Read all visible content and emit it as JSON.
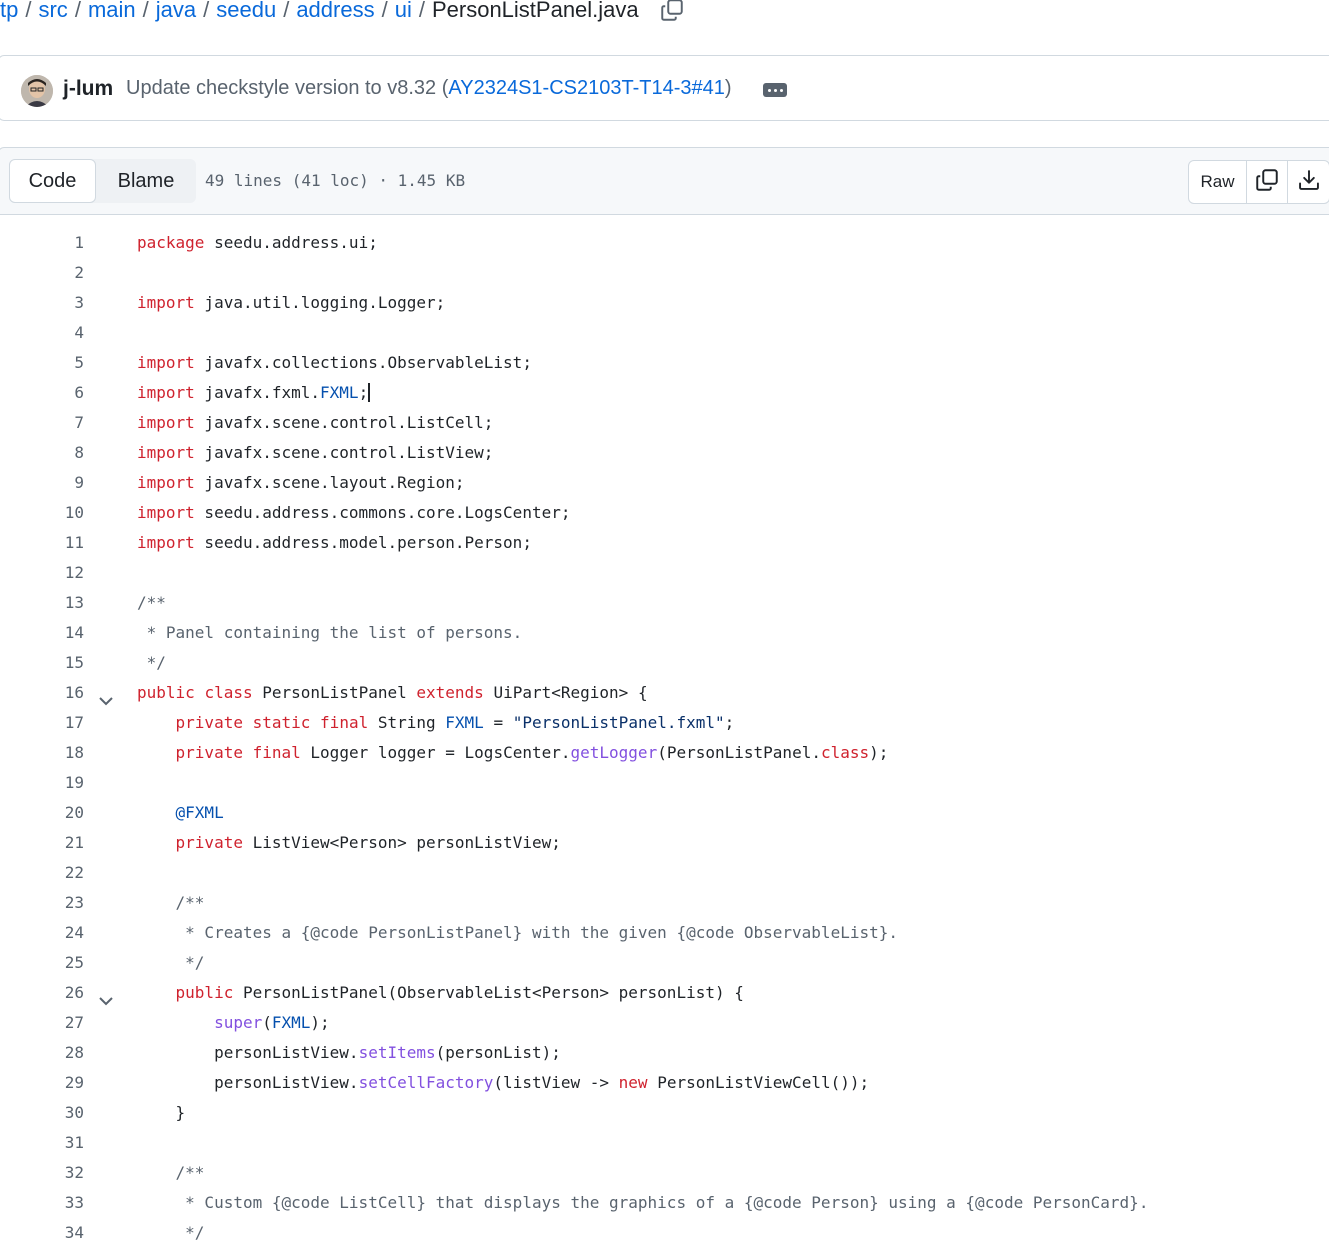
{
  "breadcrumb": {
    "items": [
      "tp",
      "src",
      "main",
      "java",
      "seedu",
      "address",
      "ui"
    ],
    "current": "PersonListPanel.java",
    "separator": "/"
  },
  "commit": {
    "author": "j-lum",
    "message": "Update checkstyle version to v8.32 (",
    "pr": "AY2324S1-CS2103T-T14-3#41",
    "message_end": ")"
  },
  "file_header": {
    "tabs": [
      "Code",
      "Blame"
    ],
    "active_tab": "Code",
    "info": "49 lines (41 loc) · 1.45 KB",
    "raw_label": "Raw"
  },
  "code": {
    "lines": [
      {
        "n": "1",
        "text": "package seedu.address.ui;"
      },
      {
        "n": "2",
        "text": ""
      },
      {
        "n": "3",
        "text": "import java.util.logging.Logger;"
      },
      {
        "n": "4",
        "text": ""
      },
      {
        "n": "5",
        "text": "import javafx.collections.ObservableList;"
      },
      {
        "n": "6",
        "text": "import javafx.fxml.FXML;"
      },
      {
        "n": "7",
        "text": "import javafx.scene.control.ListCell;"
      },
      {
        "n": "8",
        "text": "import javafx.scene.control.ListView;"
      },
      {
        "n": "9",
        "text": "import javafx.scene.layout.Region;"
      },
      {
        "n": "10",
        "text": "import seedu.address.commons.core.LogsCenter;"
      },
      {
        "n": "11",
        "text": "import seedu.address.model.person.Person;"
      },
      {
        "n": "12",
        "text": ""
      },
      {
        "n": "13",
        "text": "/**"
      },
      {
        "n": "14",
        "text": " * Panel containing the list of persons."
      },
      {
        "n": "15",
        "text": " */"
      },
      {
        "n": "16",
        "text": "public class PersonListPanel extends UiPart<Region> {",
        "fold": true
      },
      {
        "n": "17",
        "text": "    private static final String FXML = \"PersonListPanel.fxml\";"
      },
      {
        "n": "18",
        "text": "    private final Logger logger = LogsCenter.getLogger(PersonListPanel.class);"
      },
      {
        "n": "19",
        "text": ""
      },
      {
        "n": "20",
        "text": "    @FXML"
      },
      {
        "n": "21",
        "text": "    private ListView<Person> personListView;"
      },
      {
        "n": "22",
        "text": ""
      },
      {
        "n": "23",
        "text": "    /**"
      },
      {
        "n": "24",
        "text": "     * Creates a {@code PersonListPanel} with the given {@code ObservableList}."
      },
      {
        "n": "25",
        "text": "     */"
      },
      {
        "n": "26",
        "text": "    public PersonListPanel(ObservableList<Person> personList) {",
        "fold": true
      },
      {
        "n": "27",
        "text": "        super(FXML);"
      },
      {
        "n": "28",
        "text": "        personListView.setItems(personList);"
      },
      {
        "n": "29",
        "text": "        personListView.setCellFactory(listView -> new PersonListViewCell());"
      },
      {
        "n": "30",
        "text": "    }"
      },
      {
        "n": "31",
        "text": ""
      },
      {
        "n": "32",
        "text": "    /**"
      },
      {
        "n": "33",
        "text": "     * Custom {@code ListCell} that displays the graphics of a {@code Person} using a {@code PersonCard}."
      },
      {
        "n": "34",
        "text": "     */"
      }
    ]
  },
  "colors": {
    "link": "#0969da",
    "keyword": "#cf222e",
    "comment": "#59636e",
    "constant": "#0550ae",
    "string": "#0a3069",
    "function": "#8250df"
  },
  "icons": {
    "copy_path": "copy-icon",
    "ellipsis": "kebab-horizontal-icon",
    "copy_raw": "copy-icon",
    "download": "download-icon",
    "fold": "chevron-down-icon"
  }
}
